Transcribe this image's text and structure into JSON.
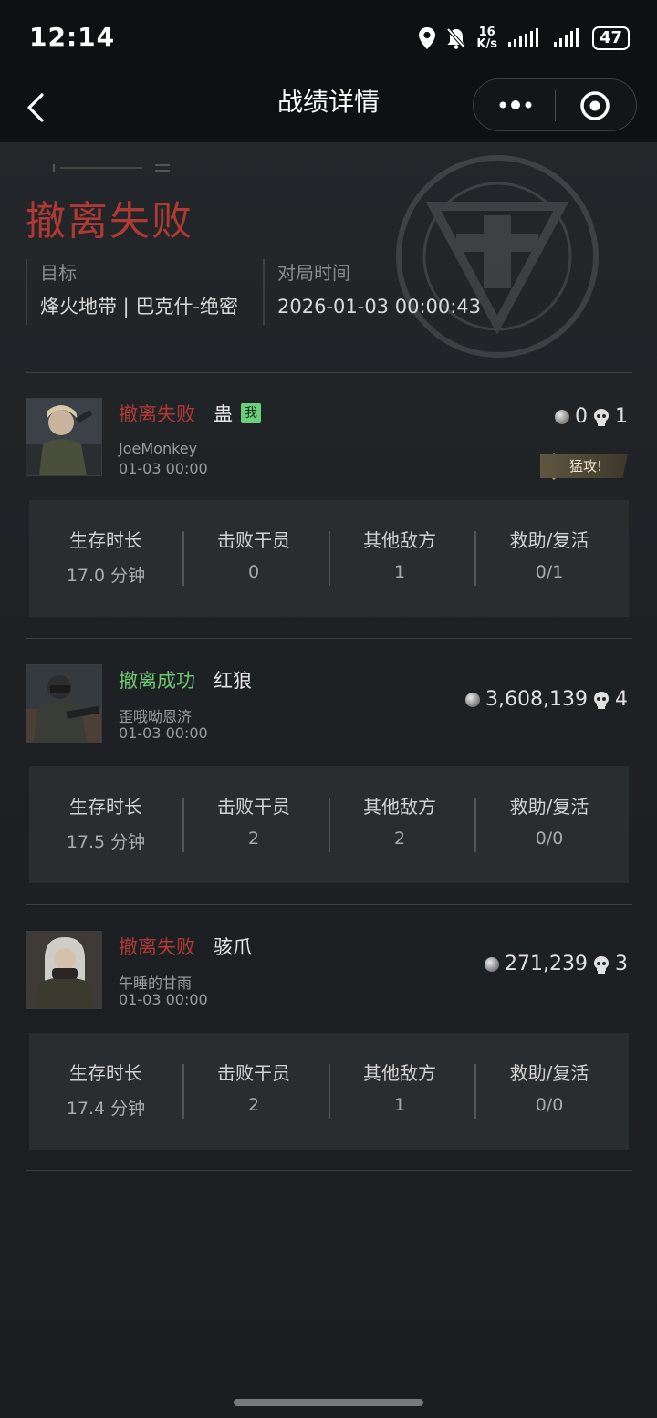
{
  "status_bar": {
    "time": "12:14",
    "speed_value": "16",
    "speed_unit": "K/s",
    "battery": "47"
  },
  "nav": {
    "title": "战绩详情"
  },
  "summary": {
    "result": "撤离失败",
    "target_label": "目标",
    "target_value": "烽火地带 | 巴克什-绝密",
    "match_time_label": "对局时间",
    "match_time_value": "2026-01-03 00:00:43"
  },
  "stat_labels": [
    "生存时长",
    "击败干员",
    "其他敌方",
    "救助/复活"
  ],
  "players": [
    {
      "status": "撤离失败",
      "status_type": "fail",
      "operator": "蛊",
      "is_me": true,
      "me_label": "我",
      "name": "JoeMonkey",
      "time": "01-03 00:00",
      "coins": "0",
      "kills": "1",
      "badge": "猛攻!",
      "stats": [
        "17.0 分钟",
        "0",
        "1",
        "0/1"
      ]
    },
    {
      "status": "撤离成功",
      "status_type": "success",
      "operator": "红狼",
      "is_me": false,
      "name": "歪哦呦恩济",
      "time": "01-03 00:00",
      "coins": "3,608,139",
      "kills": "4",
      "stats": [
        "17.5 分钟",
        "2",
        "2",
        "0/0"
      ]
    },
    {
      "status": "撤离失败",
      "status_type": "fail",
      "operator": "骇爪",
      "is_me": false,
      "name": "午睡的甘雨",
      "time": "01-03 00:00",
      "coins": "271,239",
      "kills": "3",
      "stats": [
        "17.4 分钟",
        "2",
        "1",
        "0/0"
      ]
    }
  ],
  "colors": {
    "fail": "#b03a33",
    "success": "#6ec874",
    "background": "#1b1d1f"
  }
}
